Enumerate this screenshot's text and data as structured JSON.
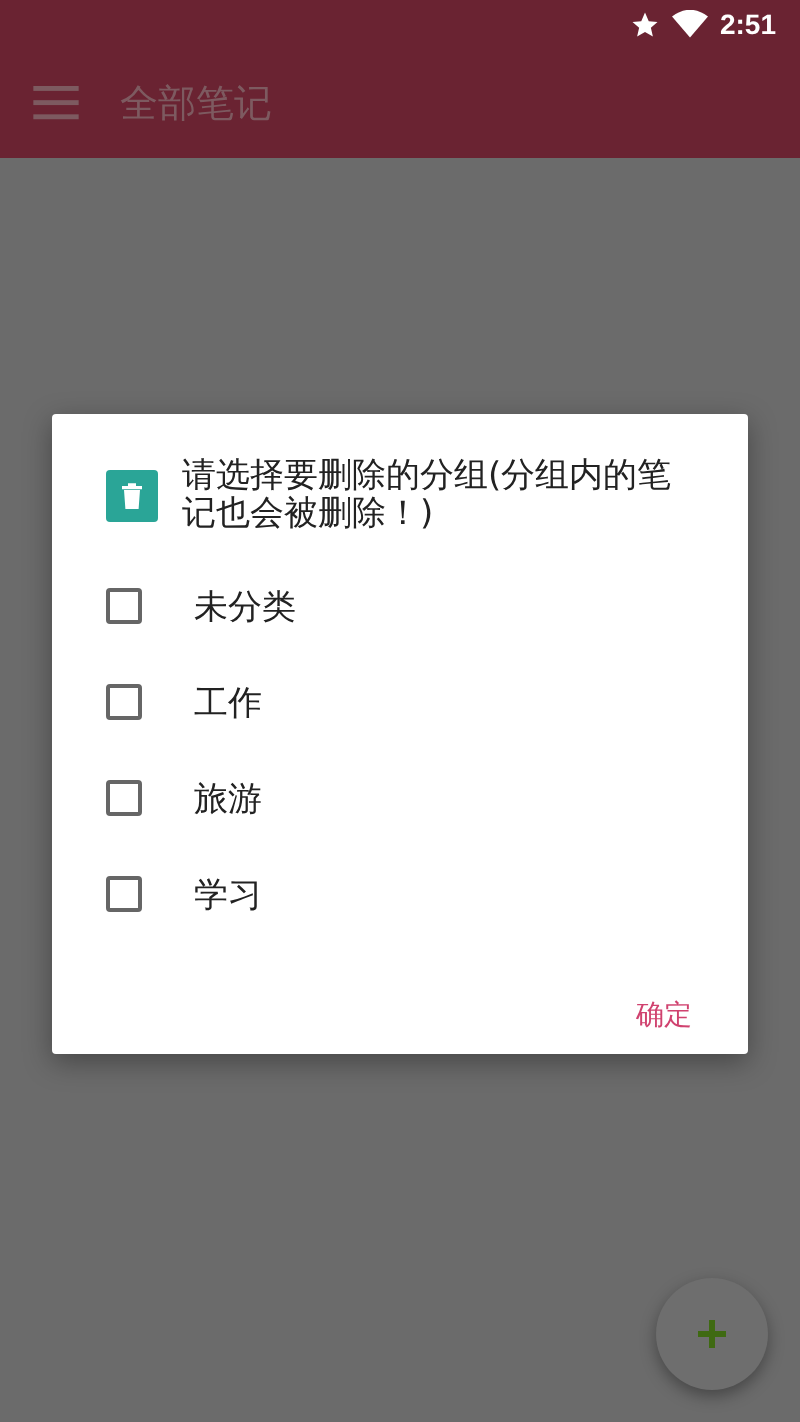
{
  "status_bar": {
    "time": "2:51"
  },
  "toolbar": {
    "title": "全部笔记"
  },
  "dialog": {
    "title": "请选择要删除的分组(分组内的笔记也会被删除！)",
    "options": [
      {
        "label": "未分类",
        "checked": false
      },
      {
        "label": "工作",
        "checked": false
      },
      {
        "label": "旅游",
        "checked": false
      },
      {
        "label": "学习",
        "checked": false
      }
    ],
    "confirm": "确定"
  }
}
